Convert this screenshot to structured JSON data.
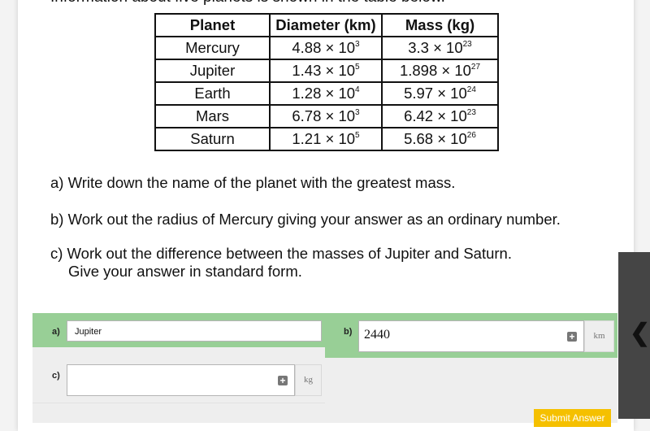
{
  "intro_text": "Information about five planets is shown in the table below.",
  "table": {
    "headers": [
      "Planet",
      "Diameter (km)",
      "Mass (kg)"
    ],
    "rows": [
      {
        "planet": "Mercury",
        "diam_base": "4.88 × 10",
        "diam_exp": "3",
        "mass_base": "3.3 × 10",
        "mass_exp": "23"
      },
      {
        "planet": "Jupiter",
        "diam_base": "1.43 × 10",
        "diam_exp": "5",
        "mass_base": "1.898 × 10",
        "mass_exp": "27"
      },
      {
        "planet": "Earth",
        "diam_base": "1.28 × 10",
        "diam_exp": "4",
        "mass_base": "5.97 × 10",
        "mass_exp": "24"
      },
      {
        "planet": "Mars",
        "diam_base": "6.78 × 10",
        "diam_exp": "3",
        "mass_base": "6.42 × 10",
        "mass_exp": "23"
      },
      {
        "planet": "Saturn",
        "diam_base": "1.21 × 10",
        "diam_exp": "5",
        "mass_base": "5.68 × 10",
        "mass_exp": "26"
      }
    ]
  },
  "questions": {
    "a": "a) Write down the name of the planet with the greatest mass.",
    "b": "b) Work out the radius of Mercury giving your answer as an ordinary number.",
    "c_line1": "c) Work out the difference between the masses of Jupiter and Saturn.",
    "c_line2": "Give your answer in standard form."
  },
  "answers": {
    "a": {
      "label": "a)",
      "value": "Jupiter"
    },
    "b": {
      "label": "b)",
      "value": "2440",
      "unit": "km"
    },
    "c": {
      "label": "c)",
      "value": "",
      "unit": "kg"
    }
  },
  "submit_label": "Submit Answer",
  "side_tab_icon": "chevron-left-icon",
  "colors": {
    "correct_bg": "#98cf96",
    "submit_bg": "#f5c000",
    "side_tab_bg": "#454545"
  }
}
